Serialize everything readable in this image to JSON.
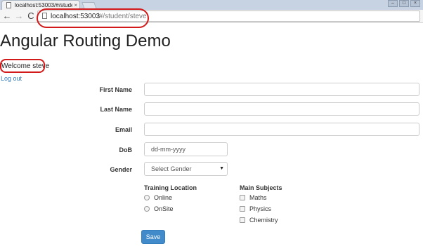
{
  "browser": {
    "tab_title": "localhost:53003/#/studen",
    "tab_close": "×",
    "url_host": "localhost:53003",
    "url_path": "/#/student/steve",
    "back_glyph": "←",
    "forward_glyph": "→",
    "reload_glyph": "C",
    "window_controls": [
      "–",
      "□",
      "×"
    ],
    "icons": [
      "page-icon",
      "back-arrow-icon",
      "forward-arrow-icon",
      "reload-icon"
    ],
    "highlight_color": "#d21a1a"
  },
  "page": {
    "title": "Angular Routing Demo",
    "welcome": "Welcome steve",
    "logout": "Log out",
    "link_color": "#337ab7"
  },
  "form": {
    "first_name_label": "First Name",
    "last_name_label": "Last Name",
    "email_label": "Email",
    "dob_label": "DoB",
    "dob_placeholder": "dd-mm-yyyy",
    "gender_label": "Gender",
    "gender_selected": "Select Gender",
    "gender_arrow": "▼",
    "training_location_label": "Training Location",
    "training_locations": [
      "Online",
      "OnSite"
    ],
    "main_subjects_label": "Main Subjects",
    "main_subjects": [
      "Maths",
      "Physics",
      "Chemistry"
    ],
    "save_label": "Save",
    "button_color": "#428bca"
  }
}
